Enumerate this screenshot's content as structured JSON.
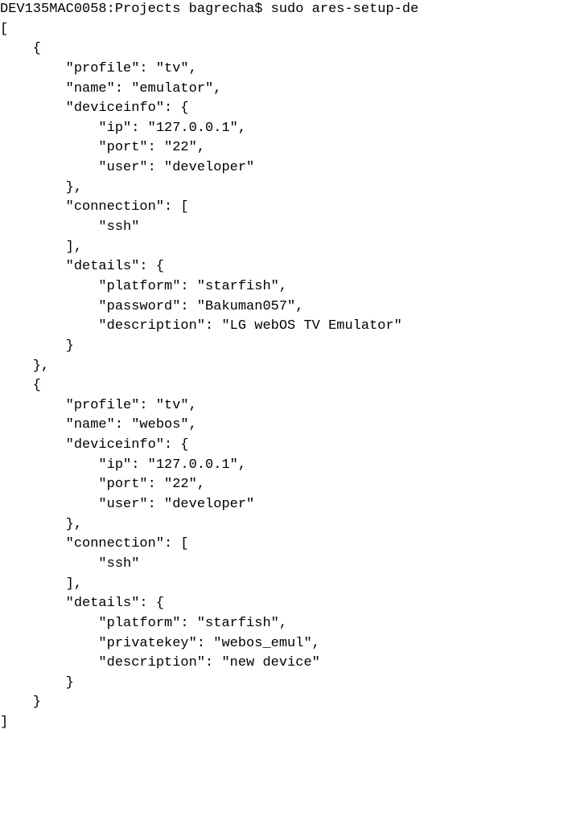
{
  "prompt": "DEV135MAC0058:Projects bagrecha$ sudo ares-setup-de",
  "output": "[\n    {\n        \"profile\": \"tv\",\n        \"name\": \"emulator\",\n        \"deviceinfo\": {\n            \"ip\": \"127.0.0.1\",\n            \"port\": \"22\",\n            \"user\": \"developer\"\n        },\n        \"connection\": [\n            \"ssh\"\n        ],\n        \"details\": {\n            \"platform\": \"starfish\",\n            \"password\": \"Bakuman057\",\n            \"description\": \"LG webOS TV Emulator\"\n        }\n    },\n    {\n        \"profile\": \"tv\",\n        \"name\": \"webos\",\n        \"deviceinfo\": {\n            \"ip\": \"127.0.0.1\",\n            \"port\": \"22\",\n            \"user\": \"developer\"\n        },\n        \"connection\": [\n            \"ssh\"\n        ],\n        \"details\": {\n            \"platform\": \"starfish\",\n            \"privatekey\": \"webos_emul\",\n            \"description\": \"new device\"\n        }\n    }\n]"
}
